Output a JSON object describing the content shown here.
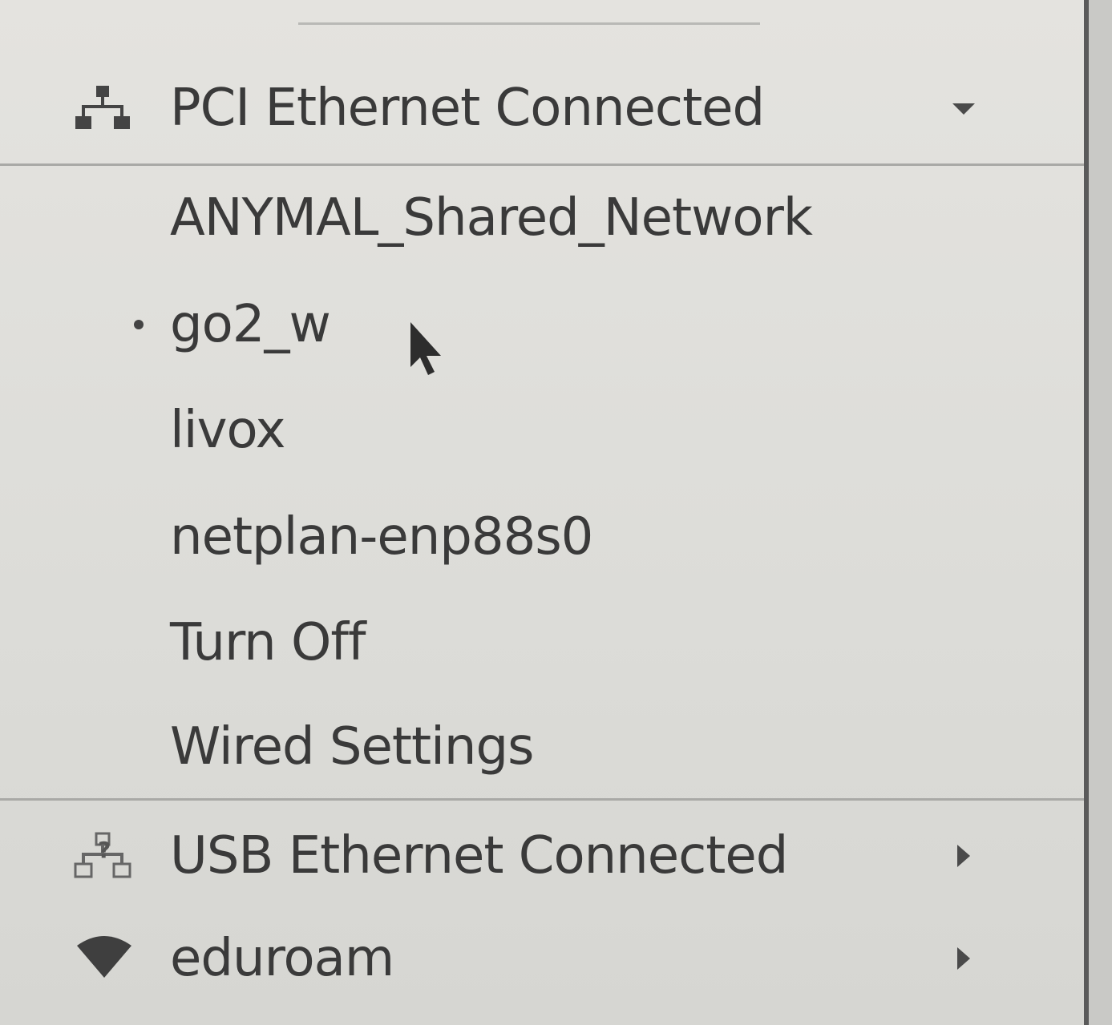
{
  "menu": {
    "pci_ethernet": {
      "label": "PCI Ethernet Connected",
      "icon": "wired-network-icon",
      "expanded": true,
      "connections": [
        {
          "label": "ANYMAL_Shared_Network",
          "active": false
        },
        {
          "label": "go2_w",
          "active": true
        },
        {
          "label": "livox",
          "active": false
        },
        {
          "label": "netplan-enp88s0",
          "active": false
        }
      ],
      "turn_off_label": "Turn Off",
      "settings_label": "Wired Settings"
    },
    "usb_ethernet": {
      "label": "USB Ethernet Connected",
      "icon": "wired-network-question-icon"
    },
    "wifi": {
      "label": "eduroam",
      "icon": "wifi-icon"
    }
  },
  "colors": {
    "menu_background": "#dcdcd8",
    "text": "#3a3a3a",
    "separator": "#a9a9a6"
  }
}
